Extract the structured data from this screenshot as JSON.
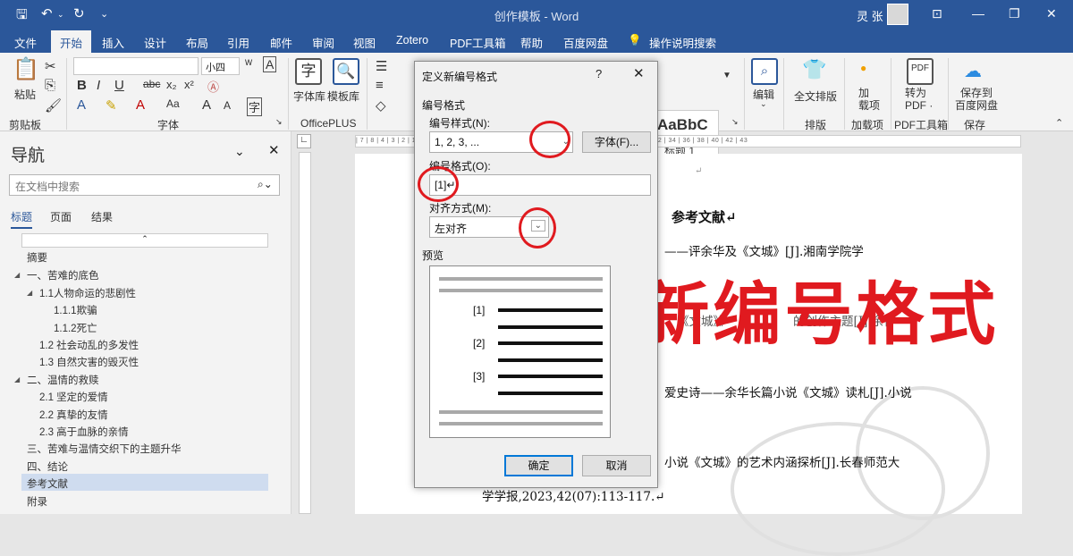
{
  "window": {
    "title": "创作模板 - Word",
    "user": "灵 张"
  },
  "tabs": [
    "文件",
    "开始",
    "插入",
    "设计",
    "布局",
    "引用",
    "邮件",
    "审阅",
    "视图",
    "Zotero",
    "PDF工具箱",
    "帮助",
    "百度网盘",
    "操作说明搜索"
  ],
  "ribbon": {
    "paste": "粘贴",
    "clipboard": "剪贴板",
    "font_group": "字体",
    "font_size": "小四",
    "font_name": "",
    "officeplus_group": "OfficePLUS",
    "font_lib": "字体库",
    "template_lib": "模板库",
    "style_preview": "AaBbC",
    "style_name": "标题 1",
    "edit": "编辑",
    "full_layout": "全文排版",
    "layout_group": "排版",
    "load_items": "加\n载项",
    "addins_group": "加载项",
    "to_pdf": "转为\nPDF ·",
    "pdf_group": "PDF工具箱",
    "save_baidu": "保存到\n百度网盘",
    "save_group": "保存"
  },
  "nav": {
    "title": "导航",
    "search_placeholder": "在文档中搜索",
    "tabs": [
      "标题",
      "页面",
      "结果"
    ],
    "items": [
      {
        "label": "摘要",
        "level": 1
      },
      {
        "label": "一、苦难的底色",
        "level": 1
      },
      {
        "label": "1.1人物命运的悲剧性",
        "level": 2
      },
      {
        "label": "1.1.1欺骗",
        "level": 3
      },
      {
        "label": "1.1.2死亡",
        "level": 3
      },
      {
        "label": "1.2 社会动乱的多发性",
        "level": 2
      },
      {
        "label": "1.3 自然灾害的毁灭性",
        "level": 2
      },
      {
        "label": "二、温情的救赎",
        "level": 1
      },
      {
        "label": "2.1 坚定的爱情",
        "level": 2
      },
      {
        "label": "2.2 真挚的友情",
        "level": 2
      },
      {
        "label": "2.3 高于血脉的亲情",
        "level": 2
      },
      {
        "label": "三、苦难与温情交织下的主题升华",
        "level": 1
      },
      {
        "label": "四、结论",
        "level": 1
      },
      {
        "label": "参考文献",
        "level": 1
      },
      {
        "label": "附录",
        "level": 1
      }
    ]
  },
  "ruler_text": "| 7 | 8 | 4 | 3 | 2 | 1 |   | 2 | 4 | 6 | 8 | 10 | 12 | 14 | 16 | 17 | 18 | 19 | 20 | 22 | 24 | 26 | 28 | 30 | 32 | 34 | 36 | 38 | 40 | 42 | 43",
  "document": {
    "heading": "参考文献↵",
    "line1": "——评余华及《文城》[J].湘南学院学",
    "line2": "《文城》》",
    "line2b": "的创作主题[J].余作",
    "line3": "爱史诗——余华长篇小说《文城》读札[J].小说",
    "line4": "小说《文城》的艺术内涵探析[J].长春师范大",
    "line5": "学学报,2023,42(07):113-117.↵",
    "overlay": "2 新编号格式"
  },
  "dialog": {
    "title": "定义新编号格式",
    "help": "?",
    "close": "✕",
    "section": "编号格式",
    "style_label": "编号样式(N):",
    "style_value": "1, 2, 3, ...",
    "font_button": "字体(F)...",
    "format_label": "编号格式(O):",
    "format_value": "[1]↵",
    "align_label": "对齐方式(M):",
    "align_value": "左对齐",
    "preview_label": "预览",
    "preview_numbers": [
      "[1]",
      "[2]",
      "[3]"
    ],
    "ok": "确定",
    "cancel": "取消"
  },
  "colors": {
    "accent": "#2b579a",
    "annotation_red": "#e01a1f"
  }
}
